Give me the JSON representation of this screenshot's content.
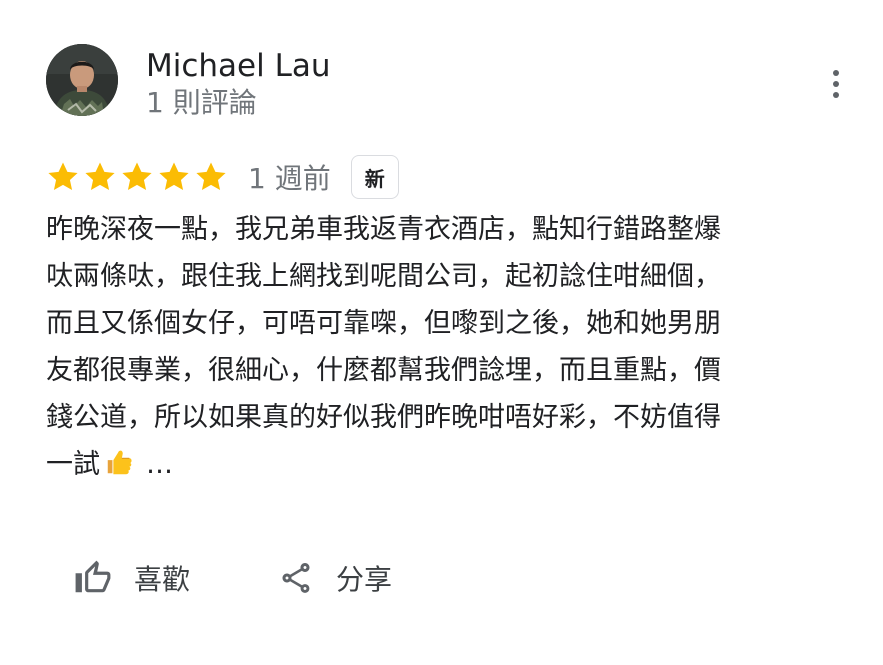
{
  "reviewer": {
    "name": "Michael Lau",
    "review_count": "1 則評論"
  },
  "rating": {
    "stars": 5,
    "max_stars": 5,
    "color": "#fbbc04",
    "date": "1 週前",
    "badge": "新"
  },
  "review": {
    "lines": [
      "昨晚深夜一點，我兄弟車我返青衣酒店，點知行錯路整爆",
      "呔兩條呔，跟住我上網找到呢間公司，起初諗住咁細個，",
      "而且又係個女仔，可唔可靠㗎，但嚟到之後，她和她男朋",
      "友都很專業，很細心，什麼都幫我們諗埋，而且重點，價",
      "錢公道，所以如果真的好似我們昨晚咁唔好彩，不妨值得",
      "一試"
    ],
    "emoji": "thumbs-up-emoji",
    "more": "…"
  },
  "actions": {
    "like_label": "喜歡",
    "like_icon": "thumbs-up-outline-icon",
    "share_label": "分享",
    "share_icon": "share-icon"
  },
  "menu": {
    "icon": "more-vertical-icon"
  }
}
